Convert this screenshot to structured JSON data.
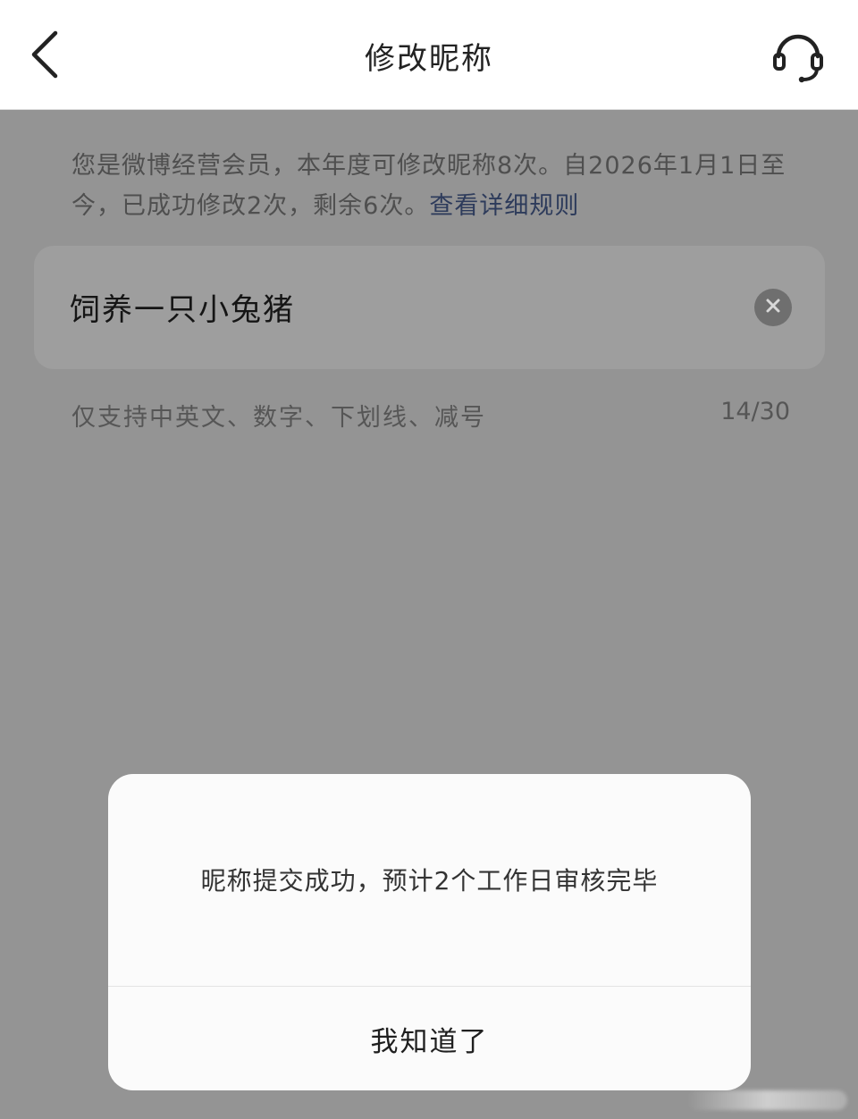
{
  "header": {
    "title": "修改昵称",
    "back_icon": "chevron-left-icon",
    "support_icon": "headset-icon"
  },
  "info": {
    "text": "您是微博经营会员，本年度可修改昵称8次。自2026年1月1日至今，已成功修改2次，剩余6次。",
    "link_text": "查看详细规则"
  },
  "nickname": {
    "value": "饲养一只小兔猪",
    "clear_icon": "clear-icon"
  },
  "hint": {
    "text": "仅支持中英文、数字、下划线、减号",
    "count": "14/30"
  },
  "modal": {
    "message": "昵称提交成功，预计2个工作日审核完毕",
    "confirm_label": "我知道了"
  },
  "colors": {
    "overlay": "#949494",
    "link": "#2d3b5b",
    "modal_bg": "#fbfbfb"
  }
}
